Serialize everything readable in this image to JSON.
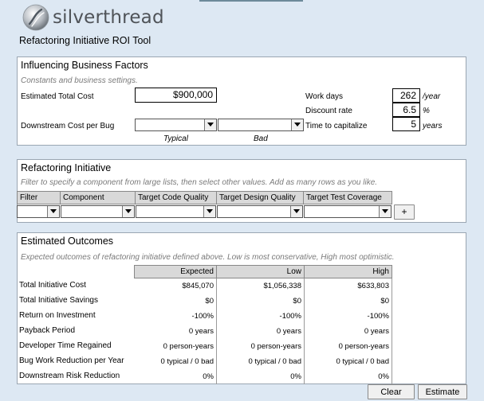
{
  "brand": {
    "name": "silverthread"
  },
  "app": {
    "title": "Refactoring Initiative ROI Tool"
  },
  "factors": {
    "title": "Influencing Business Factors",
    "subtitle": "Constants and business settings.",
    "estimated_total_cost_label": "Estimated Total Cost",
    "estimated_total_cost": "$900,000",
    "downstream_cost_label": "Downstream Cost per Bug",
    "typical_label": "Typical",
    "bad_label": "Bad",
    "work_days_label": "Work days",
    "work_days": "262",
    "work_days_unit": "/year",
    "discount_rate_label": "Discount rate",
    "discount_rate": "6.5",
    "discount_rate_unit": "%",
    "time_to_capitalize_label": "Time to capitalize",
    "time_to_capitalize": "5",
    "time_to_capitalize_unit": "years"
  },
  "initiative": {
    "title": "Refactoring Initiative",
    "subtitle": "Filter to specify a component from large lists, then select other values.  Add as many rows as you like.",
    "columns": [
      "Filter",
      "Component",
      "Target Code Quality",
      "Target Design Quality",
      "Target Test Coverage"
    ],
    "add_label": "+"
  },
  "outcomes": {
    "title": "Estimated Outcomes",
    "subtitle": "Expected outcomes of refactoring initiative defined above.  Low is most conservative, High most optimistic.",
    "columns": [
      "Expected",
      "Low",
      "High"
    ],
    "rows": [
      {
        "label": "Total Initiative Cost",
        "values": [
          "$845,070",
          "$1,056,338",
          "$633,803"
        ]
      },
      {
        "label": "Total Initiative Savings",
        "values": [
          "$0",
          "$0",
          "$0"
        ]
      },
      {
        "label": "Return on Investment",
        "values": [
          "-100%",
          "-100%",
          "-100%"
        ]
      },
      {
        "label": "Payback Period",
        "values": [
          "0 years",
          "0 years",
          "0 years"
        ]
      },
      {
        "label": "Developer Time Regained",
        "values": [
          "0 person-years",
          "0 person-years",
          "0 person-years"
        ]
      },
      {
        "label": "Bug Work Reduction per Year",
        "values": [
          "0 typical / 0 bad",
          "0 typical / 0 bad",
          "0 typical / 0 bad"
        ]
      },
      {
        "label": "Downstream Risk Reduction",
        "values": [
          "0%",
          "0%",
          "0%"
        ]
      }
    ]
  },
  "buttons": {
    "clear": "Clear",
    "estimate": "Estimate"
  },
  "colors": {
    "background": "#dde8f3",
    "header_fill": "#d9d9d9"
  }
}
